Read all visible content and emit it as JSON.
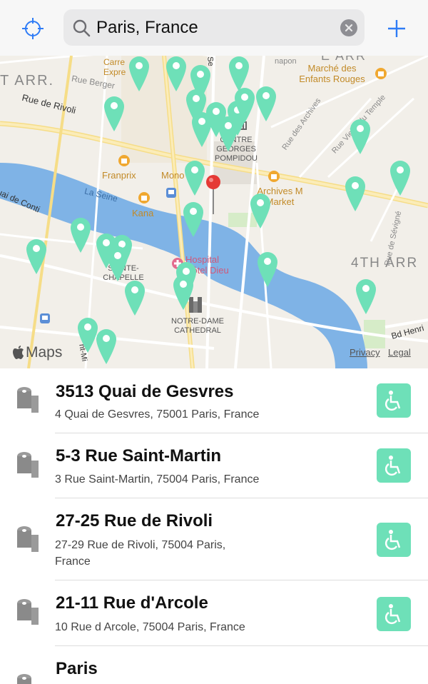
{
  "search": {
    "value": "Paris, France"
  },
  "map": {
    "labels": {
      "arr1": "T ARR.",
      "rue_berger": "Rue Berger",
      "rue_rivoli": "Rue de Rivoli",
      "carrefour": "Carre Expre",
      "se": "Se",
      "napon": "napon",
      "arr3_top": "E ARR",
      "marche": "Marché des Enfants Rouges",
      "rue_archives": "Rue des Archives",
      "rue_temple": "Rue Vieille du Temple",
      "centre_pompidou": "CENTRE GEORGES POMPIDOU",
      "franprix": "Franprix",
      "mono": "Mono",
      "archives_market": "Archives M Market",
      "quai_conti": "uai de Conti",
      "la_seine": "La Seine",
      "kana": "Kana",
      "hospital": "Hospital Hôtel Dieu",
      "sainte_chapelle": "SAINTE-CHAPELLE",
      "arr4": "4TH ARR",
      "rue_sevigne": "Rue de Sévigné",
      "notre_dame": "NOTRE-DAME CATHEDRAL",
      "bd_henri": "Bd Henri",
      "bd": "Bd",
      "ml": "nt-Mi"
    },
    "maps_logo": "Maps",
    "privacy": "Privacy",
    "legal": "Legal",
    "pin_color": "#6ee0b8",
    "selected_pin_color": "#e53935"
  },
  "results": [
    {
      "title": "3513 Quai de Gesvres",
      "address": "4 Quai de Gesvres, 75001 Paris, France",
      "accessible": true
    },
    {
      "title": "5-3 Rue Saint-Martin",
      "address": "3 Rue Saint-Martin, 75004 Paris, France",
      "accessible": true
    },
    {
      "title": "27-25 Rue de Rivoli",
      "address": "27-29 Rue de Rivoli, 75004 Paris, France",
      "accessible": true
    },
    {
      "title": "21-11 Rue d'Arcole",
      "address": "10 Rue d Arcole, 75004 Paris, France",
      "accessible": true
    },
    {
      "title": "Paris",
      "address": "",
      "accessible": false
    }
  ],
  "icons": {
    "locate": "crosshair-icon",
    "search": "search-icon",
    "clear": "clear-icon",
    "add": "plus-icon",
    "toilet": "toilet-paper-icon",
    "accessible": "wheelchair-icon"
  },
  "colors": {
    "accent": "#2f7cf6",
    "accessible_badge": "#6ee0b8"
  }
}
